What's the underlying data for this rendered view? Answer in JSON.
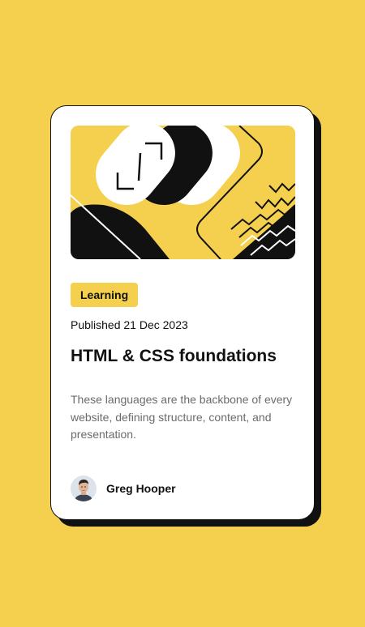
{
  "card": {
    "tag": "Learning",
    "published": "Published 21 Dec 2023",
    "title": "HTML & CSS foundations",
    "description": "These languages are the backbone of every website, defining structure, content, and presentation.",
    "author": {
      "name": "Greg Hooper"
    }
  },
  "colors": {
    "background": "#F4D04E",
    "card": "#FFFFFF",
    "ink": "#111111",
    "muted_text": "#6B6B6B"
  },
  "icons": {
    "hero": "abstract-illustration",
    "avatar": "author-avatar"
  }
}
